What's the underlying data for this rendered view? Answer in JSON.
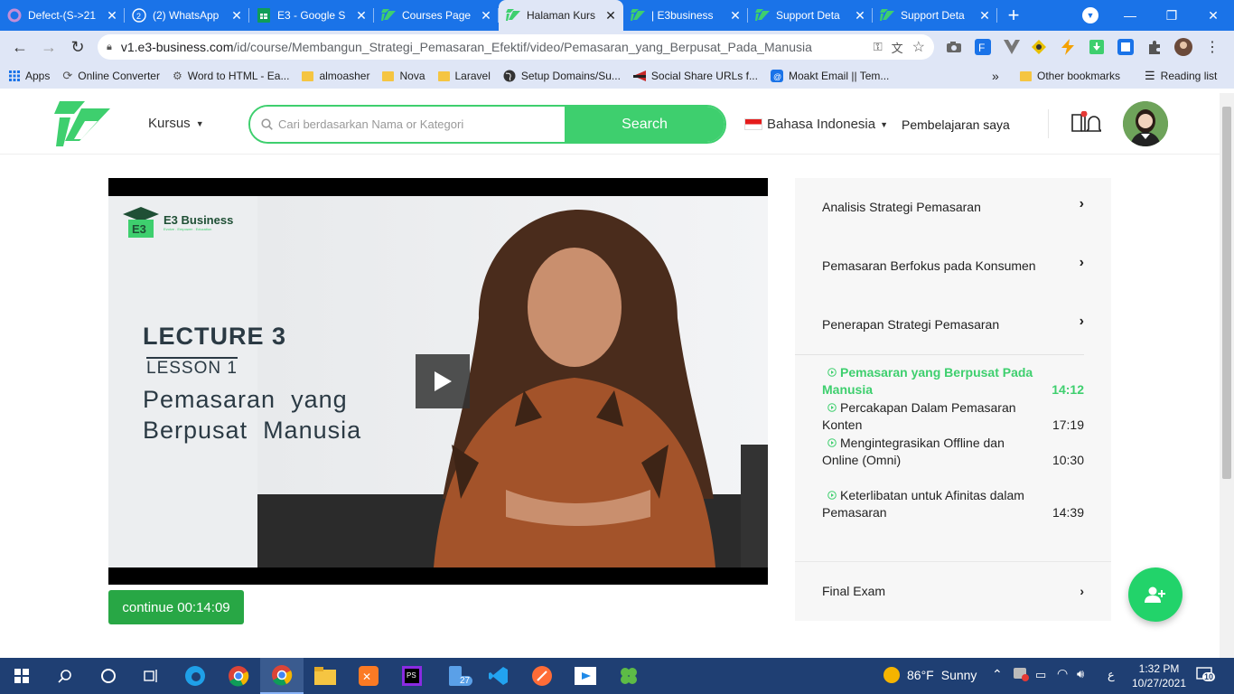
{
  "browser": {
    "tabs": [
      {
        "title": "Defect-(S->21",
        "icon": "defect-icon",
        "active": false
      },
      {
        "title": "(2) WhatsApp",
        "icon": "whatsapp-icon",
        "active": false
      },
      {
        "title": "E3 - Google S",
        "icon": "google-sheets-icon",
        "active": false
      },
      {
        "title": "Courses Page",
        "icon": "e3-logo-icon",
        "active": false
      },
      {
        "title": "Halaman Kurs",
        "icon": "e3-logo-icon",
        "active": true
      },
      {
        "title": "| E3business",
        "icon": "e3-logo-icon",
        "active": false
      },
      {
        "title": "Support Deta",
        "icon": "e3-logo-icon",
        "active": false
      },
      {
        "title": "Support Deta",
        "icon": "e3-logo-icon",
        "active": false
      }
    ],
    "url_host": "v1.e3-business.com",
    "url_path": "/id/course/Membangun_Strategi_Pemasaran_Efektif/video/Pemasaran_yang_Berpusat_Pada_Manusia",
    "bookmarks": [
      {
        "label": "Apps",
        "icon": "apps-grid-icon"
      },
      {
        "label": "Online Converter",
        "icon": "converter-icon"
      },
      {
        "label": "Word to HTML - Ea...",
        "icon": "gear-icon"
      },
      {
        "label": "almoasher",
        "icon": "folder-icon"
      },
      {
        "label": "Nova",
        "icon": "folder-icon"
      },
      {
        "label": "Laravel",
        "icon": "folder-icon"
      },
      {
        "label": "Setup Domains/Su...",
        "icon": "globe-icon"
      },
      {
        "label": "Social Share URLs f...",
        "icon": "share-icon"
      },
      {
        "label": "Moakt Email || Tem...",
        "icon": "email-icon"
      }
    ],
    "bookmarks_more": "»",
    "other_bookmarks": "Other bookmarks",
    "reading_list": "Reading list",
    "whatsapp_badge": "2"
  },
  "site": {
    "nav_courses": "Kursus",
    "search_placeholder": "Cari berdasarkan Nama or Kategori",
    "search_button": "Search",
    "language": "Bahasa Indonesia",
    "my_learning": "Pembelajaran saya",
    "accent": "#3ecf6e"
  },
  "video": {
    "brand": "E3 Business",
    "brand_tagline": "Evolve . Empower . Education",
    "lecture": "LECTURE 3",
    "lesson": "LESSON 1",
    "title_line1": "Pemasaran  yang",
    "title_line2": "Berpusat  Manusia",
    "continue_label": "continue 00:14:09"
  },
  "curriculum": {
    "sections": [
      "Analisis Strategi Pemasaran",
      "Pemasaran Berfokus pada Konsumen",
      "Penerapan Strategi Pemasaran"
    ],
    "lessons": [
      {
        "title": "Pemasaran yang Berpusat Pada Manusia",
        "duration": "14:12",
        "active": true
      },
      {
        "title": "Percakapan Dalam Pemasaran Konten",
        "duration": "17:19",
        "active": false
      },
      {
        "title": "Mengintegrasikan Offline dan Online (Omni)",
        "duration": "10:30",
        "active": false
      },
      {
        "title": "Keterlibatan untuk Afinitas dalam Pemasaran",
        "duration": "14:39",
        "active": false
      }
    ],
    "final_exam": "Final Exam"
  },
  "taskbar": {
    "weather_temp": "86°F",
    "weather_text": "Sunny",
    "time": "1:32 PM",
    "date": "10/27/2021",
    "notification_count": "10",
    "taskbar_badge": "27",
    "lang_indicator": "ع"
  }
}
